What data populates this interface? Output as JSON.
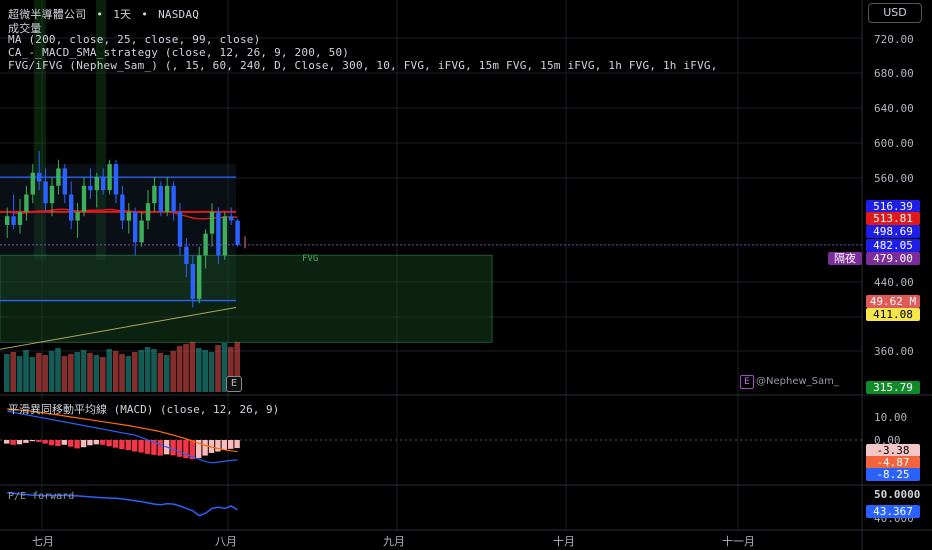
{
  "header": {
    "symbol": "超微半導體公司",
    "interval": "1天",
    "exchange": "NASDAQ",
    "separator": "•",
    "volume_label": "成交量",
    "indicator_ma": "MA (200, close, 25, close, 99, close)",
    "indicator_macd_strategy": "CA_-_MACD_SMA_strategy (close, 12, 26, 9, 200, 50)",
    "indicator_fvg": "FVG/iFVG (Nephew_Sam_) (, 15, 60, 240, D, Close, 300, 10, FVG, iFVG, 15m FVG, 15m iFVG, 1h FVG, 1h iFVG,"
  },
  "currency_button": "USD",
  "macd_title": "平滑異同移動平均線 (MACD) (close, 12, 26, 9)",
  "pe_title": "P/E forward",
  "fvg_label": "FVG",
  "night_label": "隔夜",
  "author_label": "@Nephew_Sam_",
  "author_badge": "E",
  "earnings_badge": "E",
  "price_axis_ticks": [
    "720.00",
    "680.00",
    "640.00",
    "600.00",
    "560.00",
    "440.00",
    "400.00",
    "360.00"
  ],
  "price_tags": [
    {
      "label": "516.39",
      "bg": "#1e1ee6",
      "fg": "#ffffff"
    },
    {
      "label": "513.81",
      "bg": "#e01a1a",
      "fg": "#ffffff"
    },
    {
      "label": "498.69",
      "bg": "#1e1ee6",
      "fg": "#ffffff"
    },
    {
      "label": "482.05",
      "bg": "#1e1ee6",
      "fg": "#ffffff"
    },
    {
      "label": "479.00",
      "bg": "#7b2d9c",
      "fg": "#ffffff"
    },
    {
      "label": "49.62 M",
      "bg": "#e05a5a",
      "fg": "#ffffff"
    },
    {
      "label": "411.08",
      "bg": "#f5e64a",
      "fg": "#000000"
    },
    {
      "label": "315.79",
      "bg": "#138a2a",
      "fg": "#ffffff"
    }
  ],
  "macd_axis_ticks": [
    "10.00",
    "0.00"
  ],
  "macd_tags": [
    {
      "label": "-3.38",
      "bg": "#f5c6c6",
      "fg": "#000000"
    },
    {
      "label": "-4.87",
      "bg": "#f2643c",
      "fg": "#ffffff"
    },
    {
      "label": "-8.25",
      "bg": "#2962ff",
      "fg": "#ffffff"
    }
  ],
  "pe_axis_ticks": [
    "50.0000",
    "40.000"
  ],
  "pe_tag": {
    "label": "43.367",
    "bg": "#2962ff",
    "fg": "#ffffff"
  },
  "time_axis": [
    "七月",
    "八月",
    "九月",
    "十月",
    "十一月"
  ],
  "colors": {
    "up": "#26a69a",
    "down": "#ef5350",
    "candle_up": "#3fae5a",
    "candle_down": "#2962ff",
    "ma": "#e01a1a",
    "fvg": "#3fae5a"
  },
  "chart_data": [
    {
      "type": "candlestick",
      "title": "超微半導體公司 • 1天 • NASDAQ",
      "ylim": [
        300,
        750
      ],
      "x_range_labels": [
        "七月",
        "八月",
        "九月",
        "十月",
        "十一月"
      ],
      "candles": [
        {
          "o": 505,
          "h": 525,
          "l": 490,
          "c": 515
        },
        {
          "o": 515,
          "h": 540,
          "l": 500,
          "c": 505
        },
        {
          "o": 505,
          "h": 535,
          "l": 495,
          "c": 520
        },
        {
          "o": 520,
          "h": 550,
          "l": 510,
          "c": 540
        },
        {
          "o": 540,
          "h": 575,
          "l": 530,
          "c": 565
        },
        {
          "o": 565,
          "h": 590,
          "l": 545,
          "c": 555
        },
        {
          "o": 555,
          "h": 570,
          "l": 520,
          "c": 530
        },
        {
          "o": 530,
          "h": 560,
          "l": 515,
          "c": 550
        },
        {
          "o": 550,
          "h": 580,
          "l": 540,
          "c": 570
        },
        {
          "o": 570,
          "h": 575,
          "l": 530,
          "c": 540
        },
        {
          "o": 540,
          "h": 555,
          "l": 500,
          "c": 510
        },
        {
          "o": 510,
          "h": 530,
          "l": 490,
          "c": 520
        },
        {
          "o": 520,
          "h": 560,
          "l": 515,
          "c": 550
        },
        {
          "o": 550,
          "h": 570,
          "l": 535,
          "c": 545
        },
        {
          "o": 545,
          "h": 565,
          "l": 525,
          "c": 560
        },
        {
          "o": 560,
          "h": 570,
          "l": 540,
          "c": 545
        },
        {
          "o": 545,
          "h": 580,
          "l": 540,
          "c": 575
        },
        {
          "o": 575,
          "h": 580,
          "l": 530,
          "c": 540
        },
        {
          "o": 540,
          "h": 550,
          "l": 500,
          "c": 510
        },
        {
          "o": 510,
          "h": 530,
          "l": 495,
          "c": 520
        },
        {
          "o": 520,
          "h": 525,
          "l": 470,
          "c": 485
        },
        {
          "o": 485,
          "h": 520,
          "l": 480,
          "c": 510
        },
        {
          "o": 510,
          "h": 545,
          "l": 500,
          "c": 530
        },
        {
          "o": 530,
          "h": 560,
          "l": 520,
          "c": 550
        },
        {
          "o": 550,
          "h": 555,
          "l": 515,
          "c": 520
        },
        {
          "o": 520,
          "h": 560,
          "l": 515,
          "c": 550
        },
        {
          "o": 550,
          "h": 555,
          "l": 510,
          "c": 520
        },
        {
          "o": 520,
          "h": 530,
          "l": 470,
          "c": 480
        },
        {
          "o": 480,
          "h": 490,
          "l": 445,
          "c": 460
        },
        {
          "o": 460,
          "h": 470,
          "l": 410,
          "c": 420
        },
        {
          "o": 420,
          "h": 480,
          "l": 415,
          "c": 470
        },
        {
          "o": 470,
          "h": 500,
          "l": 455,
          "c": 495
        },
        {
          "o": 495,
          "h": 530,
          "l": 480,
          "c": 520
        },
        {
          "o": 520,
          "h": 525,
          "l": 460,
          "c": 470
        },
        {
          "o": 470,
          "h": 520,
          "l": 465,
          "c": 515
        },
        {
          "o": 515,
          "h": 525,
          "l": 505,
          "c": 510
        },
        {
          "o": 510,
          "h": 512,
          "l": 480,
          "c": 482
        }
      ],
      "ma_line": [
        520,
        519,
        518,
        519,
        520,
        521,
        521,
        522,
        523,
        523,
        522,
        521,
        521,
        522,
        522,
        522,
        523,
        522,
        521,
        521,
        520,
        519,
        519,
        520,
        520,
        520,
        519,
        517,
        515,
        513,
        512,
        512,
        513,
        513,
        514,
        514,
        514
      ],
      "levels": [
        {
          "name": "upper",
          "value": 560,
          "color": "#2962ff"
        },
        {
          "name": "middle",
          "value": 520,
          "color": "#e01a1a"
        },
        {
          "name": "lower",
          "value": 418,
          "color": "#2962ff"
        }
      ],
      "fvg_box": {
        "top": 470,
        "bottom": 370
      }
    },
    {
      "type": "bar",
      "title": "成交量",
      "values": [
        38,
        40,
        36,
        42,
        35,
        39,
        37,
        41,
        44,
        36,
        38,
        40,
        42,
        39,
        37,
        35,
        43,
        41,
        38,
        36,
        40,
        42,
        45,
        43,
        39,
        37,
        41,
        46,
        48,
        50,
        44,
        42,
        40,
        47,
        49,
        45,
        50
      ],
      "colors_up_down": "by_candle"
    },
    {
      "type": "bar",
      "title": "平滑異同移動平均線 (MACD) (close, 12, 26, 9)",
      "ylim": [
        -12,
        14
      ],
      "histogram": [
        -1.5,
        -2.0,
        -1.8,
        -1.2,
        -0.5,
        -0.8,
        -1.5,
        -2.2,
        -2.5,
        -2.0,
        -2.8,
        -3.5,
        -3.0,
        -2.2,
        -1.8,
        -2.0,
        -2.6,
        -3.2,
        -3.8,
        -4.2,
        -4.8,
        -5.2,
        -5.8,
        -6.2,
        -6.5,
        -6.0,
        -6.4,
        -7.0,
        -7.6,
        -8.0,
        -7.5,
        -6.5,
        -5.4,
        -4.8,
        -4.2,
        -3.7,
        -3.38
      ],
      "macd_line": [
        12.0,
        11.5,
        11.0,
        10.5,
        10.0,
        9.5,
        9.0,
        8.5,
        8.0,
        7.5,
        7.0,
        6.5,
        6.0,
        5.5,
        5.0,
        4.5,
        4.0,
        3.5,
        3.0,
        2.5,
        2.0,
        1.0,
        0.0,
        -1.0,
        -2.0,
        -3.0,
        -4.0,
        -5.0,
        -6.0,
        -7.0,
        -8.0,
        -9.0,
        -9.5,
        -9.2,
        -8.8,
        -8.5,
        -8.25
      ],
      "signal_line": [
        13.0,
        12.8,
        12.5,
        12.2,
        12.0,
        11.6,
        11.2,
        10.8,
        10.4,
        10.0,
        9.6,
        9.2,
        8.8,
        8.4,
        8.0,
        7.6,
        7.2,
        6.8,
        6.4,
        6.0,
        5.5,
        5.0,
        4.5,
        4.0,
        3.4,
        2.7,
        2.0,
        1.2,
        0.4,
        -0.5,
        -1.4,
        -2.3,
        -3.0,
        -3.6,
        -4.1,
        -4.5,
        -4.87
      ]
    },
    {
      "type": "line",
      "title": "P/E forward",
      "ylim": [
        38,
        52
      ],
      "values": [
        50.5,
        50.3,
        50.0,
        49.8,
        49.5,
        49.4,
        49.3,
        49.4,
        49.5,
        49.4,
        49.3,
        49.2,
        49.0,
        48.8,
        48.6,
        48.4,
        48.3,
        48.2,
        47.9,
        47.6,
        47.2,
        46.8,
        46.3,
        45.8,
        45.5,
        46.0,
        45.8,
        45.0,
        44.0,
        43.0,
        41.0,
        42.0,
        44.0,
        44.5,
        44.0,
        45.0,
        43.367
      ]
    }
  ]
}
